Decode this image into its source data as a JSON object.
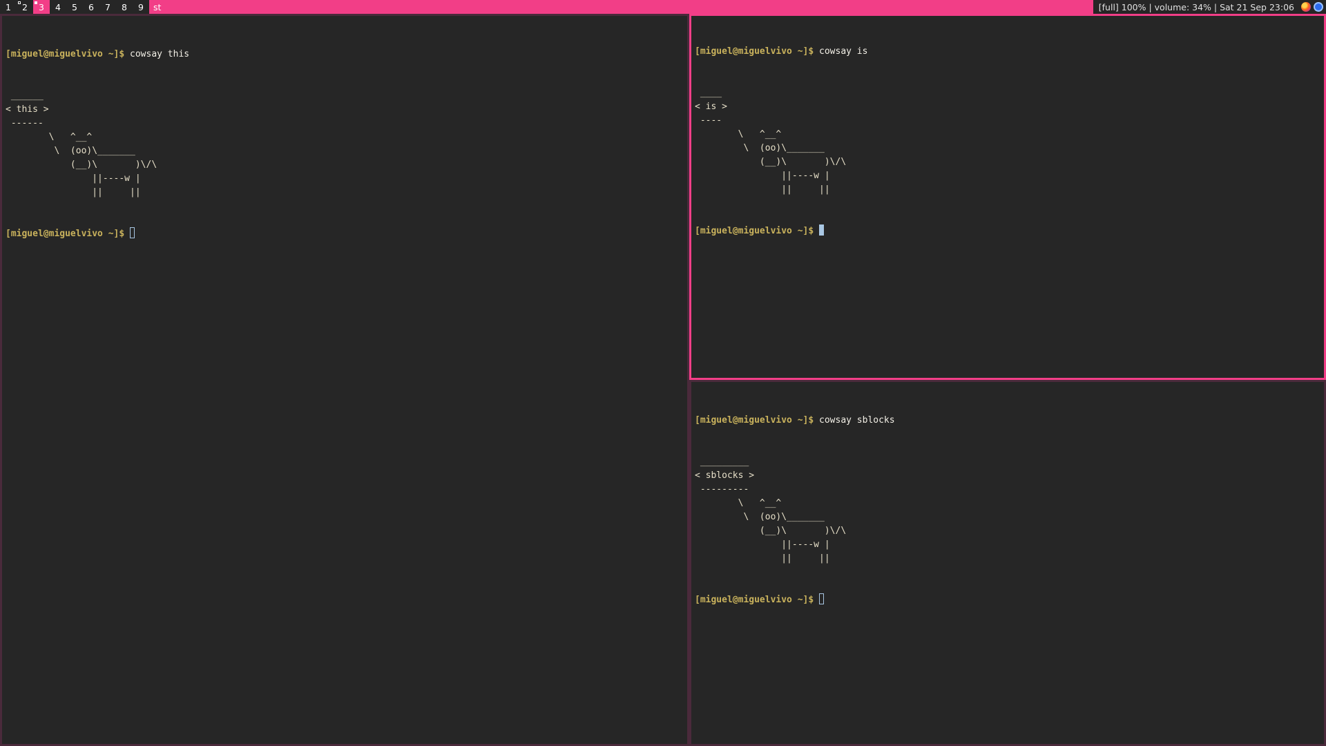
{
  "bar": {
    "tags": [
      {
        "label": "1",
        "occupied": false,
        "active": false
      },
      {
        "label": "2",
        "occupied": true,
        "active": false
      },
      {
        "label": "3",
        "occupied": true,
        "active": true
      },
      {
        "label": "4",
        "occupied": false,
        "active": false
      },
      {
        "label": "5",
        "occupied": false,
        "active": false
      },
      {
        "label": "6",
        "occupied": false,
        "active": false
      },
      {
        "label": "7",
        "occupied": false,
        "active": false
      },
      {
        "label": "8",
        "occupied": false,
        "active": false
      },
      {
        "label": "9",
        "occupied": false,
        "active": false
      }
    ],
    "window_title": "st",
    "status_text": "[full] 100% | volume: 34% | Sat 21 Sep 23:06",
    "tray_icons": [
      "firefox-icon",
      "signal-icon"
    ],
    "colors": {
      "accent": "#f23e87",
      "background": "#262626",
      "prompt": "#c9b25c"
    }
  },
  "windows": {
    "left": {
      "prompt": "[miguel@miguelvivo ~]$",
      "command": "cowsay this",
      "output": [
        " ______",
        "< this >",
        " ------",
        "        \\   ^__^",
        "         \\  (oo)\\_______",
        "            (__)\\       )\\/\\",
        "                ||----w |",
        "                ||     ||"
      ],
      "prompt2": "[miguel@miguelvivo ~]$"
    },
    "top_right": {
      "prompt": "[miguel@miguelvivo ~]$",
      "command": "cowsay is",
      "output": [
        " ____",
        "< is >",
        " ----",
        "        \\   ^__^",
        "         \\  (oo)\\_______",
        "            (__)\\       )\\/\\",
        "                ||----w |",
        "                ||     ||"
      ],
      "prompt2": "[miguel@miguelvivo ~]$"
    },
    "bottom_right": {
      "prompt": "[miguel@miguelvivo ~]$",
      "command": "cowsay sblocks",
      "output": [
        " _________",
        "< sblocks >",
        " ---------",
        "        \\   ^__^",
        "         \\  (oo)\\_______",
        "            (__)\\       )\\/\\",
        "                ||----w |",
        "                ||     ||"
      ],
      "prompt2": "[miguel@miguelvivo ~]$"
    }
  }
}
